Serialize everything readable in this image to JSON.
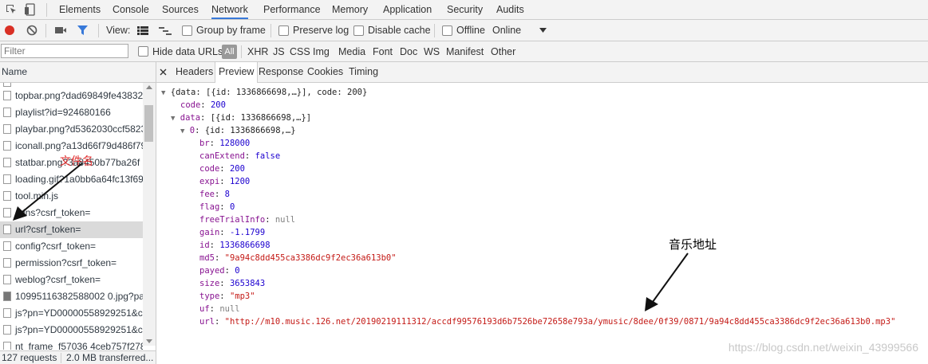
{
  "tabs": [
    "Elements",
    "Console",
    "Sources",
    "Network",
    "Performance",
    "Memory",
    "Application",
    "Security",
    "Audits"
  ],
  "active_tab": "Network",
  "toolbar": {
    "view_label": "View:",
    "group_by_frame": "Group by frame",
    "preserve_log": "Preserve log",
    "disable_cache": "Disable cache",
    "offline": "Offline",
    "throttle_value": "Online"
  },
  "filterbar": {
    "placeholder": "Filter",
    "hide_data_urls": "Hide data URLs",
    "all": "All",
    "types": [
      "XHR",
      "JS",
      "CSS",
      "Img",
      "Media",
      "Font",
      "Doc",
      "WS",
      "Manifest",
      "Other"
    ]
  },
  "requests": {
    "header": "Name",
    "items": [
      "topbar.png?dad69849fe43832",
      "playlist?id=924680166",
      "playbar.png?d5362030ccf5823",
      "iconall.png?a13d66f79d486f79",
      "statbar.png?3a8450b77ba26f",
      "loading.gif?1a0bb6a64fc13f69",
      "tool.min.js",
      "cdns?csrf_token=",
      "url?csrf_token=",
      "config?csrf_token=",
      "permission?csrf_token=",
      "weblog?csrf_token=",
      "10995116382588002 0.jpg?par",
      "js?pn=YD00000558929251&c.",
      "js?pn=YD00000558929251&c.",
      "nt_frame_f57036 4ceb757f278"
    ],
    "status_count": "127 requests",
    "status_size": "2.0 MB transferred..."
  },
  "detail_tabs": [
    "Headers",
    "Preview",
    "Response",
    "Cookies",
    "Timing"
  ],
  "active_detail_tab": "Preview",
  "preview": {
    "root": "{data: [{id: 1336866698,…}], code: 200}",
    "code_key": "code",
    "code_val": "200",
    "data_key": "data",
    "data_summary": "[{id: 1336866698,…}]",
    "item_key": "0",
    "item_summary": "{id: 1336866698,…}",
    "fields": [
      {
        "k": "br",
        "v": "128000",
        "t": "n"
      },
      {
        "k": "canExtend",
        "v": "false",
        "t": "n"
      },
      {
        "k": "code",
        "v": "200",
        "t": "n"
      },
      {
        "k": "expi",
        "v": "1200",
        "t": "n"
      },
      {
        "k": "fee",
        "v": "8",
        "t": "n"
      },
      {
        "k": "flag",
        "v": "0",
        "t": "n"
      },
      {
        "k": "freeTrialInfo",
        "v": "null",
        "t": "nul"
      },
      {
        "k": "gain",
        "v": "-1.1799",
        "t": "n"
      },
      {
        "k": "id",
        "v": "1336866698",
        "t": "n"
      },
      {
        "k": "md5",
        "v": "\"9a94c8dd455ca3386dc9f2ec36a613b0\"",
        "t": "s"
      },
      {
        "k": "payed",
        "v": "0",
        "t": "n"
      },
      {
        "k": "size",
        "v": "3653843",
        "t": "n"
      },
      {
        "k": "type",
        "v": "\"mp3\"",
        "t": "s"
      },
      {
        "k": "uf",
        "v": "null",
        "t": "nul"
      },
      {
        "k": "url",
        "v": "\"http://m10.music.126.net/20190219111312/accdf99576193d6b7526be72658e793a/ymusic/8dee/0f39/0871/9a94c8dd455ca3386dc9f2ec36a613b0.mp3\"",
        "t": "s"
      }
    ]
  },
  "annotations": {
    "file_label": "文件名",
    "music_label": "音乐地址"
  },
  "watermark": "https://blog.csdn.net/weixin_43999566",
  "colors": {
    "accent": "#3879d9",
    "record": "#d93025",
    "annotation_red": "#e03030"
  }
}
